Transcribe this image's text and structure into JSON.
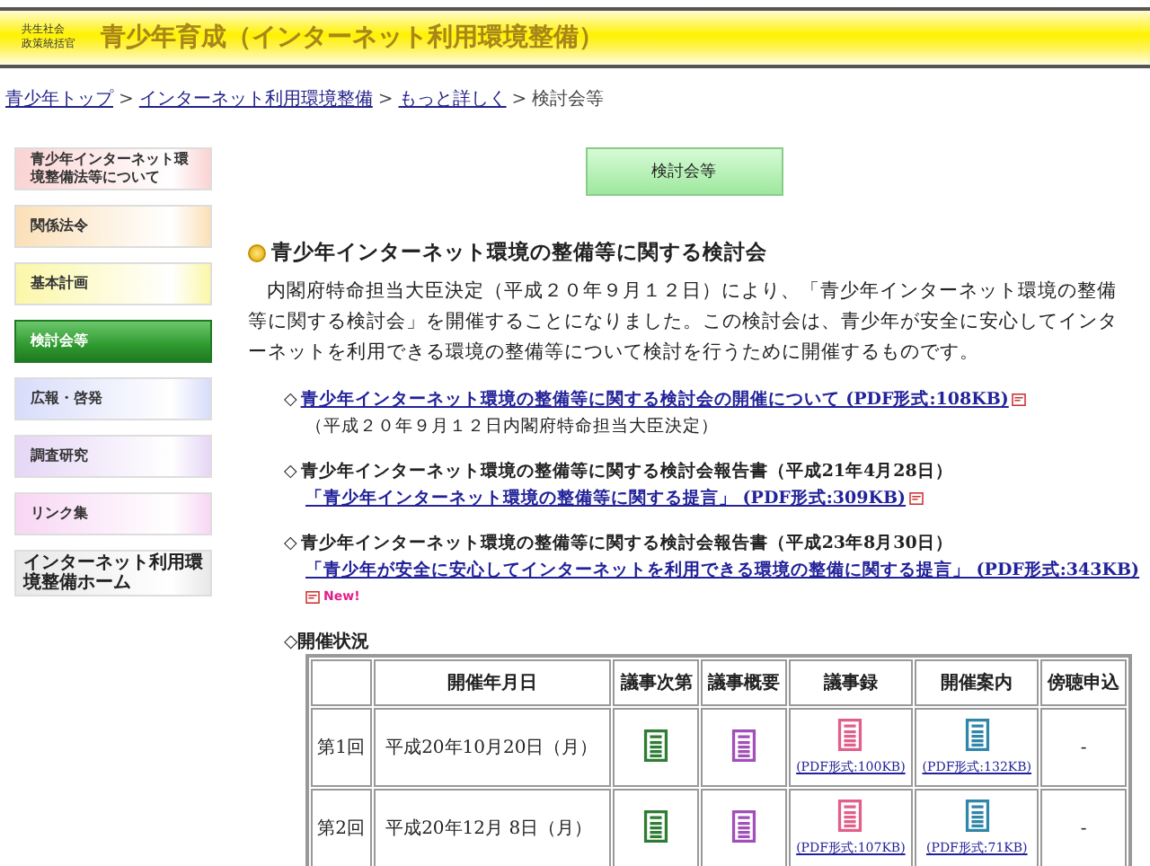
{
  "header": {
    "org_lines": [
      "共生社会",
      "政策統括官"
    ],
    "title": "青少年育成（インターネット利用環境整備）"
  },
  "breadcrumb": {
    "links": [
      "青少年トップ",
      "インターネット利用環境整備",
      "もっと詳しく"
    ],
    "separator": ">",
    "current": "検討会等"
  },
  "sidebar": {
    "items": [
      {
        "label": "青少年インターネット環境整備法等について",
        "kind": "menu",
        "color": "#fbd3d3",
        "selected": false
      },
      {
        "label": "関係法令",
        "kind": "menu",
        "color": "#fbe0b8",
        "selected": false
      },
      {
        "label": "基本計画",
        "kind": "menu",
        "color": "#fbf7a8",
        "selected": false
      },
      {
        "label": "検討会等",
        "kind": "menu",
        "color": "#2f9a2f",
        "selected": true
      },
      {
        "label": "広報・啓発",
        "kind": "menu",
        "color": "#d8dcfa",
        "selected": false
      },
      {
        "label": "調査研究",
        "kind": "menu",
        "color": "#e6d6f6",
        "selected": false
      },
      {
        "label": "リンク集",
        "kind": "menu",
        "color": "#f8d6f4",
        "selected": false
      },
      {
        "label": "インターネット利用環境整備ホーム",
        "kind": "home",
        "color": "#e8e8e8",
        "selected": false
      }
    ]
  },
  "page_heading": "検討会等",
  "section_title": "青少年インターネット環境の整備等に関する検討会",
  "intro": "内閣府特命担当大臣決定（平成２０年９月１２日）により、「青少年インターネット環境の整備等に関する検討会」を開催することになりました。この検討会は、青少年が安全に安心してインターネットを利用できる環境の整備等について検討を行うために開催するものです。",
  "documents": [
    {
      "bullet": "◇",
      "link": "青少年インターネット環境の整備等に関する検討会の開催について (PDF形式:108KB)",
      "note": "（平成２０年９月１２日内閣府特命担当大臣決定）"
    },
    {
      "bullet": "◇",
      "title": "青少年インターネット環境の整備等に関する検討会報告書（平成21年4月28日）",
      "link": "「青少年インターネット環境の整備等に関する提言」 (PDF形式:309KB)"
    },
    {
      "bullet": "◇",
      "title": "青少年インターネット環境の整備等に関する検討会報告書（平成23年8月30日）",
      "link": "「青少年が安全に安心してインターネットを利用できる環境の整備に関する提言」 (PDF形式:343KB)",
      "new_badge": "New!"
    }
  ],
  "meetings": {
    "title": "◇開催状況",
    "columns": [
      "",
      "開催年月日",
      "議事次第",
      "議事概要",
      "議事録",
      "開催案内",
      "傍聴申込"
    ],
    "rows": [
      {
        "cells": [
          {
            "kind": "text",
            "text": "第1回"
          },
          {
            "kind": "date",
            "text": "平成20年10月20日（月）"
          },
          {
            "kind": "icon",
            "color": "#2e7d32"
          },
          {
            "kind": "icon",
            "color": "#a050b8"
          },
          {
            "kind": "icon_link",
            "color": "#e0608a",
            "link": "(PDF形式:100KB)"
          },
          {
            "kind": "icon_link",
            "color": "#2f86a8",
            "link": "(PDF形式:132KB)"
          },
          {
            "kind": "text",
            "text": "-"
          }
        ]
      },
      {
        "cells": [
          {
            "kind": "text",
            "text": "第2回"
          },
          {
            "kind": "date",
            "text": "平成20年12月 8日（月）"
          },
          {
            "kind": "icon",
            "color": "#2e7d32"
          },
          {
            "kind": "icon",
            "color": "#a050b8"
          },
          {
            "kind": "icon_link",
            "color": "#e0608a",
            "link": "(PDF形式:107KB)"
          },
          {
            "kind": "icon_link",
            "color": "#2f86a8",
            "link": "(PDF形式:71KB)"
          },
          {
            "kind": "text",
            "text": "-"
          }
        ]
      }
    ]
  }
}
